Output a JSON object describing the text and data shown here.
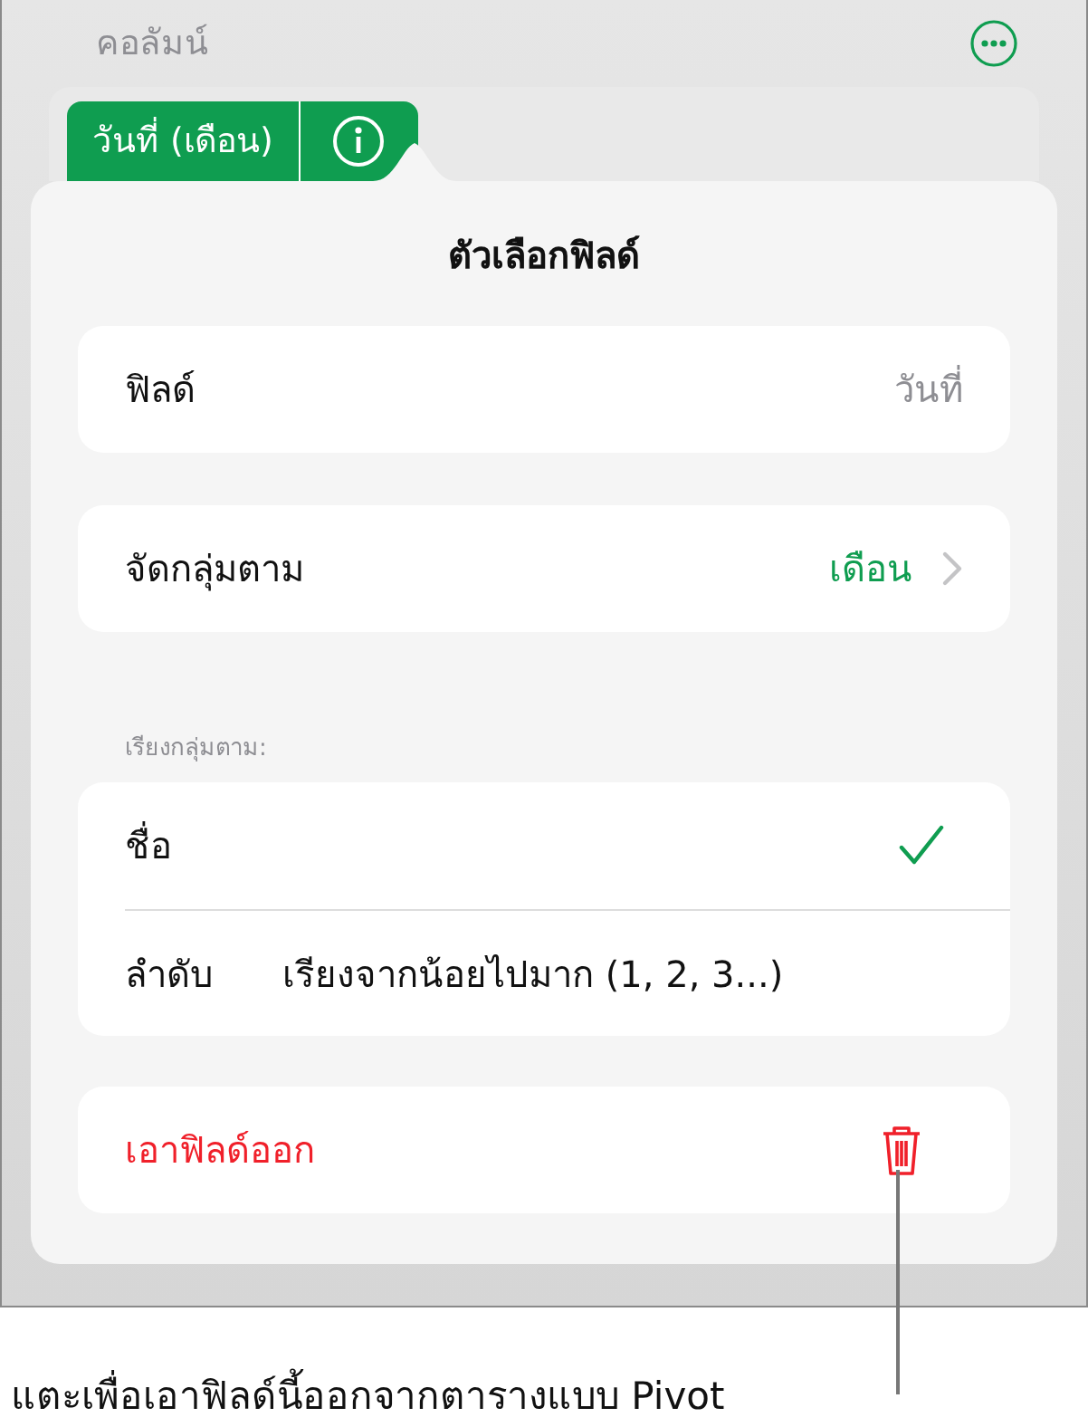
{
  "header": {
    "title": "คอลัมน์"
  },
  "fields": [
    {
      "label": "วันที่ (เดือน)",
      "selected": true
    }
  ],
  "popover": {
    "title": "ตัวเลือกฟิลด์",
    "rows": [
      {
        "kind": "value",
        "label": "ฟิลด์",
        "value": "วันที่"
      },
      {
        "kind": "link",
        "label": "จัดกลุ่มตาม",
        "value": "เดือน"
      }
    ],
    "sort_header": "เรียงกลุ่มตาม:",
    "sort_options": [
      {
        "kind": "check",
        "label": "ชื่อ",
        "checked": true
      },
      {
        "kind": "value",
        "label": "ลำดับ",
        "value": "เรียงจากน้อยไปมาก (1, 2, 3...)"
      }
    ],
    "remove": {
      "label": "เอาฟิลด์ออก"
    }
  },
  "callout": "แตะเพื่อเอาฟิลด์นี้ออกจากตารางแบบ Pivot"
}
